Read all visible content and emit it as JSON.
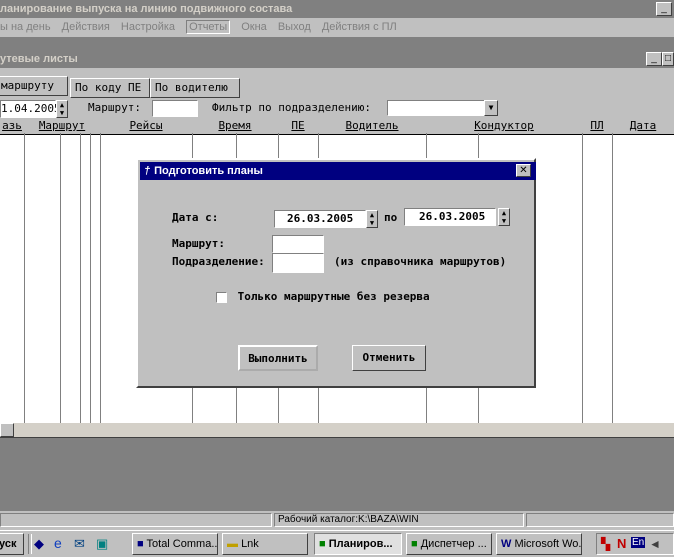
{
  "app": {
    "title": "ланирование выпуска на линию подвижного состава",
    "menu": [
      "ы на день",
      "Действия",
      "Настройка",
      "Отчеты",
      "Окна",
      "Выход",
      "Действия с ПЛ"
    ]
  },
  "child": {
    "title": "утевые листы",
    "tabs": [
      "маршруту",
      "По коду ПЕ",
      "По водителю"
    ],
    "date_value": "1.04.2005",
    "route_label": "Маршрут:",
    "filter_label": "Фильтр по подразделению:",
    "columns": [
      "азь",
      "Маршрут",
      "Рейсы",
      "Время",
      "ПЕ",
      "Водитель",
      "Кондуктор",
      "ПЛ",
      "Дата"
    ]
  },
  "dialog": {
    "title": "Подготовить планы",
    "date_from_label": "Дата с:",
    "date_from": "26.03.2005",
    "to_label": "по",
    "date_to": "26.03.2005",
    "route_label": "Маршрут:",
    "dept_label": "Подразделение:",
    "dept_hint": "(из справочника маршрутов)",
    "checkbox_label": "Только маршрутные без резерва",
    "run_button": "Выполнить",
    "cancel_button": "Отменить"
  },
  "status": {
    "workdir": "Рабочий каталог:K:\\BAZA\\WIN"
  },
  "taskbar": {
    "start": "уск",
    "tasks": [
      "Total Comma...",
      "Lnk",
      "Планиров...",
      "Диспетчер ...",
      "Microsoft Wo..."
    ],
    "tray_lang": "En"
  }
}
